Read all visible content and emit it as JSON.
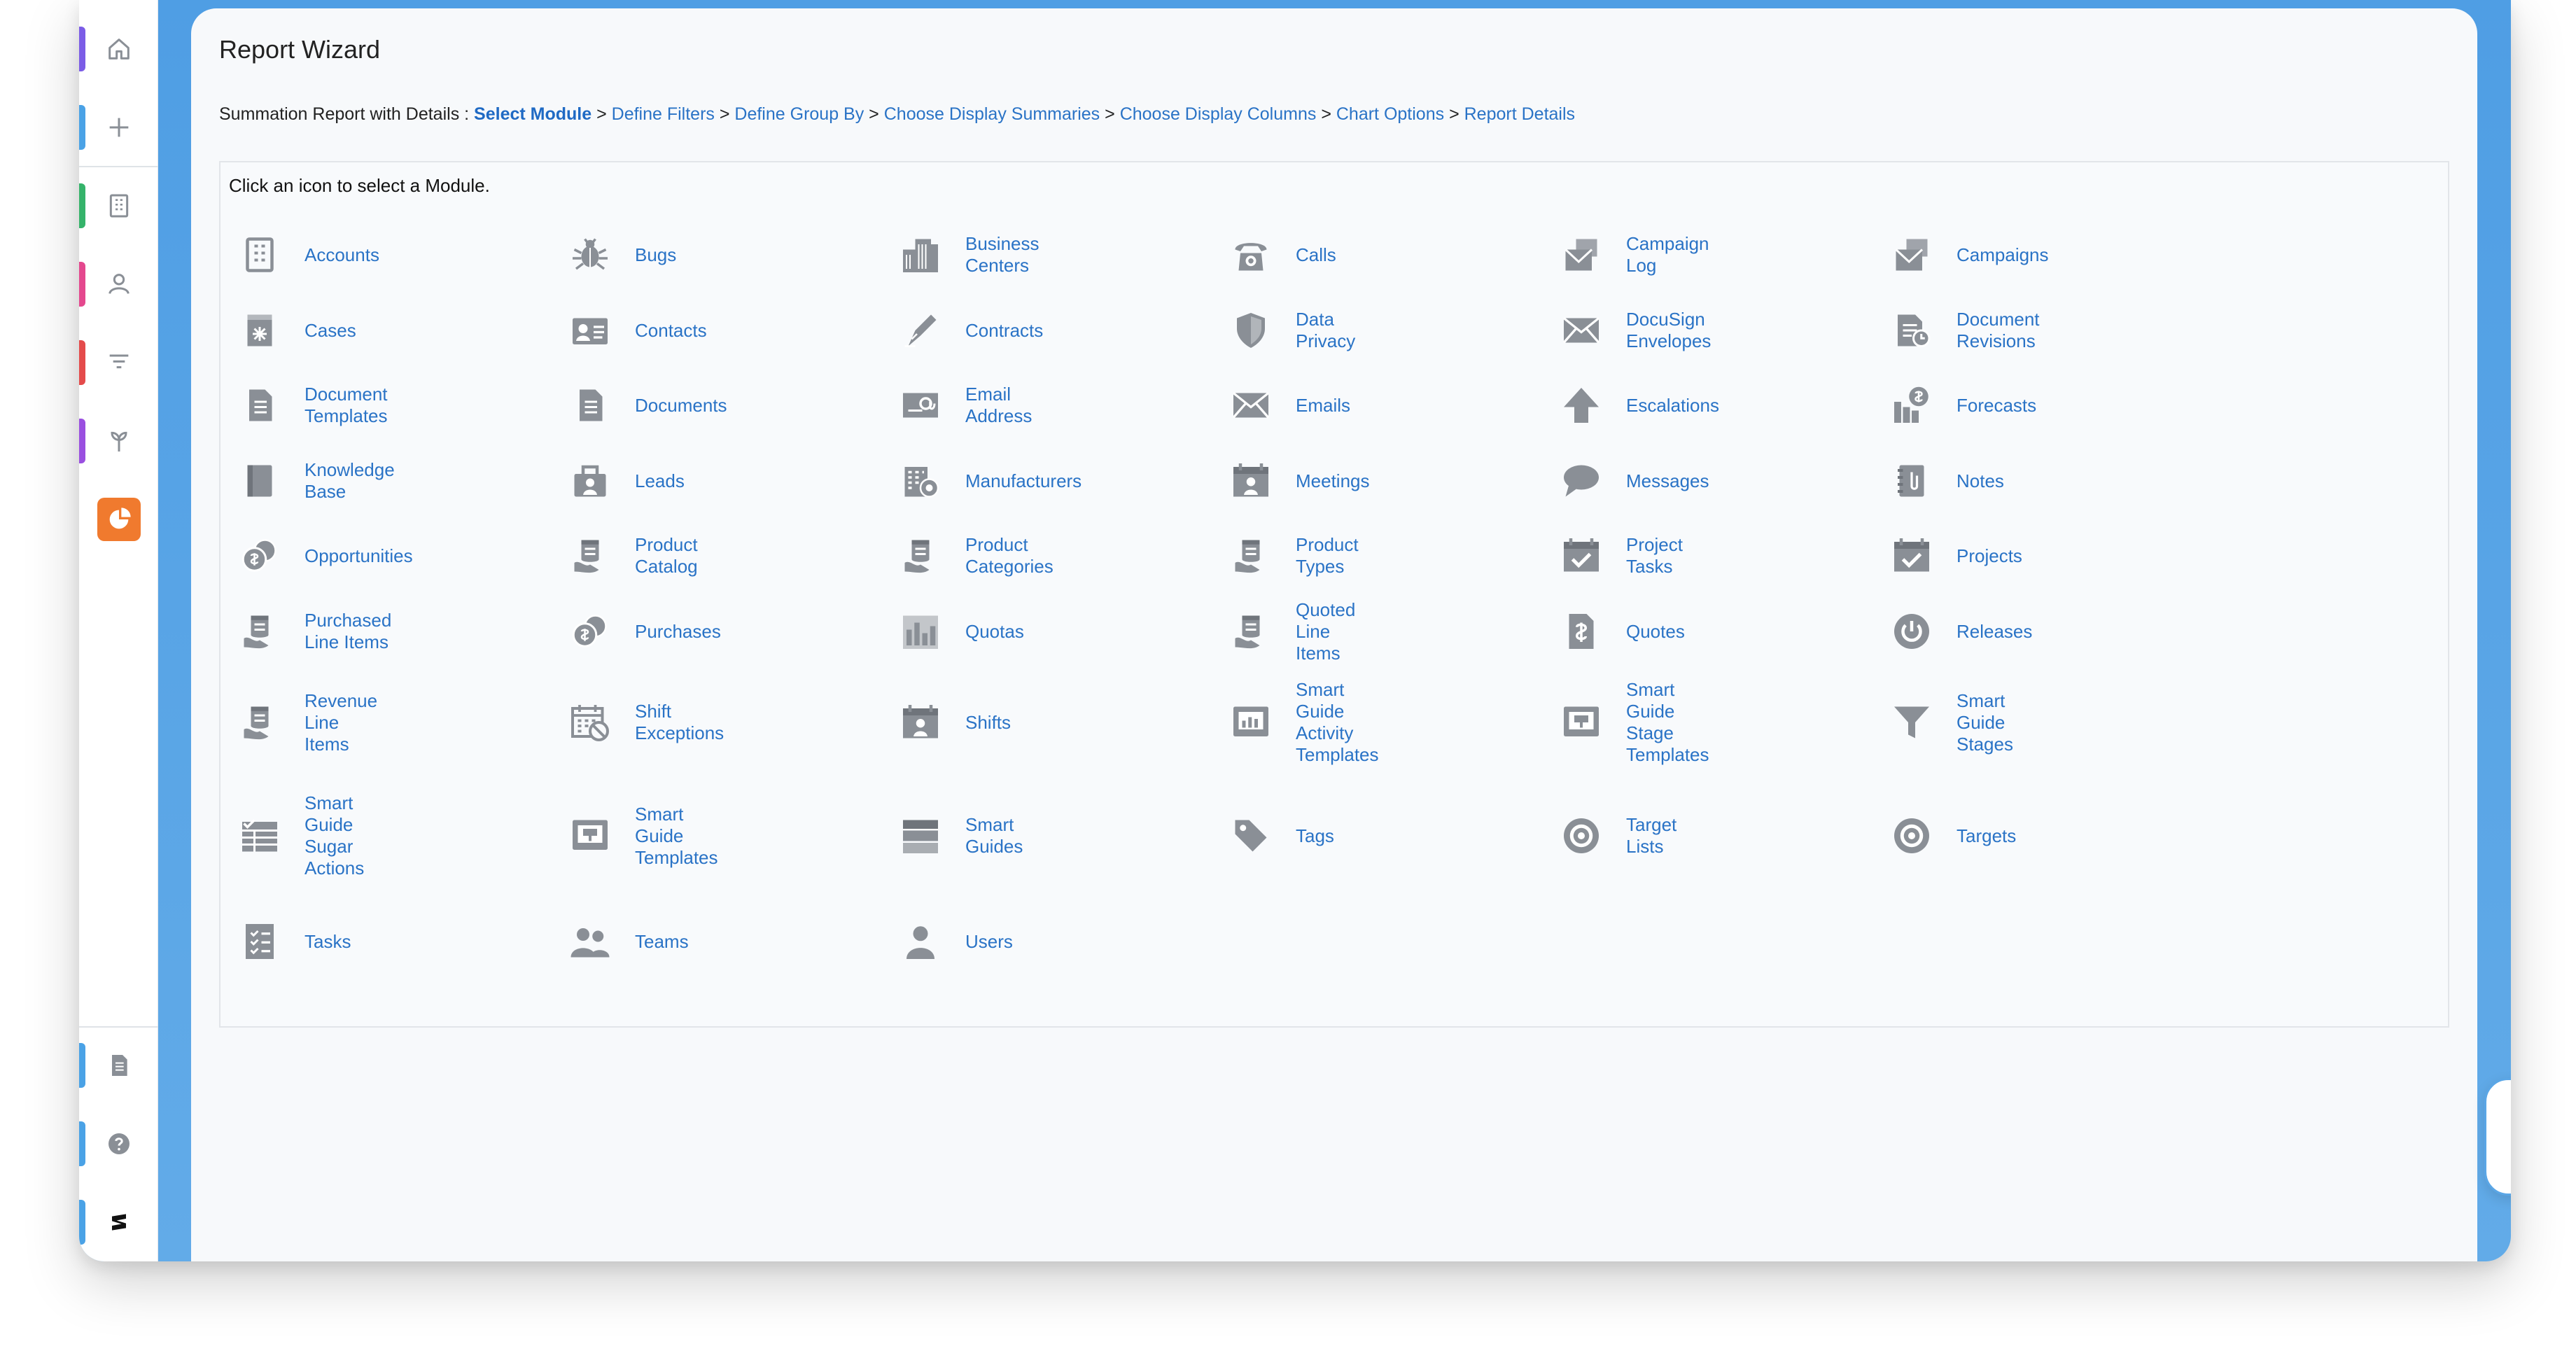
{
  "window": {
    "title": "Report Wizard",
    "colors": {
      "accent": "#2a73c6",
      "brand_orange": "#f07a2e",
      "frame": "#5aa6e6"
    }
  },
  "sidebar": {
    "top_items": [
      {
        "name": "home",
        "icon": "home-icon",
        "color": "#7b5ce6"
      },
      {
        "name": "create",
        "icon": "plus-icon",
        "color": "#4aa2e6"
      },
      {
        "name": "accounts",
        "icon": "building-icon",
        "color": "#35b36a"
      },
      {
        "name": "contacts",
        "icon": "person-icon",
        "color": "#e4488e"
      },
      {
        "name": "filters",
        "icon": "filter-icon",
        "color": "#e44b4b"
      },
      {
        "name": "opportunities",
        "icon": "plant-icon",
        "color": "#9a4fe0"
      },
      {
        "name": "reports",
        "icon": "pie-chart-icon",
        "color": "#f07a2e",
        "active": true
      }
    ],
    "bottom_items": [
      {
        "name": "notes",
        "icon": "document-icon",
        "color": "#4aa2e6"
      },
      {
        "name": "help",
        "icon": "help-icon",
        "color": "#4aa2e6"
      },
      {
        "name": "sugar",
        "icon": "sugar-logo-icon",
        "color": "#4aa2e6"
      }
    ]
  },
  "wizard": {
    "report_type": "Summation Report with Details :",
    "steps": [
      "Select Module",
      "Define Filters",
      "Define Group By",
      "Choose Display Summaries",
      "Choose Display Columns",
      "Chart Options",
      "Report Details"
    ],
    "current_step": "Select Module",
    "instruction": "Click an icon to select a Module."
  },
  "modules": [
    {
      "label": "Accounts",
      "icon": "building-icon"
    },
    {
      "label": "Bugs",
      "icon": "bug-icon"
    },
    {
      "label": "Business\nCenters",
      "icon": "office-buildings-icon"
    },
    {
      "label": "Calls",
      "icon": "phone-icon"
    },
    {
      "label": "Campaign\nLog",
      "icon": "envelope-stack-icon"
    },
    {
      "label": "Campaigns",
      "icon": "envelope-stack-icon"
    },
    {
      "label": "Cases",
      "icon": "case-icon"
    },
    {
      "label": "Contacts",
      "icon": "contact-card-icon"
    },
    {
      "label": "Contracts",
      "icon": "pen-icon"
    },
    {
      "label": "Data\nPrivacy",
      "icon": "shield-icon"
    },
    {
      "label": "DocuSign\nEnvelopes",
      "icon": "envelope-icon"
    },
    {
      "label": "Document\nRevisions",
      "icon": "document-revision-icon"
    },
    {
      "label": "Document\nTemplates",
      "icon": "document-icon"
    },
    {
      "label": "Documents",
      "icon": "document-icon"
    },
    {
      "label": "Email\nAddress",
      "icon": "email-address-icon"
    },
    {
      "label": "Emails",
      "icon": "envelope-icon"
    },
    {
      "label": "Escalations",
      "icon": "arrow-up-icon"
    },
    {
      "label": "Forecasts",
      "icon": "forecast-icon"
    },
    {
      "label": "Knowledge\nBase",
      "icon": "book-icon"
    },
    {
      "label": "Leads",
      "icon": "briefcase-person-icon"
    },
    {
      "label": "Manufacturers",
      "icon": "factory-icon"
    },
    {
      "label": "Meetings",
      "icon": "calendar-person-icon"
    },
    {
      "label": "Messages",
      "icon": "speech-bubble-icon"
    },
    {
      "label": "Notes",
      "icon": "notebook-icon"
    },
    {
      "label": "Opportunities",
      "icon": "coins-icon"
    },
    {
      "label": "Product\nCatalog",
      "icon": "product-icon"
    },
    {
      "label": "Product\nCategories",
      "icon": "product-icon"
    },
    {
      "label": "Product\nTypes",
      "icon": "product-icon"
    },
    {
      "label": "Project\nTasks",
      "icon": "calendar-check-icon"
    },
    {
      "label": "Projects",
      "icon": "calendar-check-icon"
    },
    {
      "label": "Purchased\nLine Items",
      "icon": "product-icon"
    },
    {
      "label": "Purchases",
      "icon": "coins-icon"
    },
    {
      "label": "Quotas",
      "icon": "bar-chart-icon"
    },
    {
      "label": "Quoted\nLine\nItems",
      "icon": "product-icon"
    },
    {
      "label": "Quotes",
      "icon": "dollar-document-icon"
    },
    {
      "label": "Releases",
      "icon": "power-icon"
    },
    {
      "label": "Revenue\nLine\nItems",
      "icon": "product-icon"
    },
    {
      "label": "Shift\nExceptions",
      "icon": "calendar-no-icon"
    },
    {
      "label": "Shifts",
      "icon": "calendar-person-icon"
    },
    {
      "label": "Smart\nGuide\nActivity\nTemplates",
      "icon": "monitor-chart-icon"
    },
    {
      "label": "Smart\nGuide\nStage\nTemplates",
      "icon": "monitor-icon"
    },
    {
      "label": "Smart\nGuide\nStages",
      "icon": "funnel-icon"
    },
    {
      "label": "Smart\nGuide\nSugar\nActions",
      "icon": "table-icon"
    },
    {
      "label": "Smart\nGuide\nTemplates",
      "icon": "monitor-icon"
    },
    {
      "label": "Smart\nGuides",
      "icon": "layers-icon"
    },
    {
      "label": "Tags",
      "icon": "tag-icon"
    },
    {
      "label": "Target\nLists",
      "icon": "target-icon"
    },
    {
      "label": "Targets",
      "icon": "target-icon"
    },
    {
      "label": "Tasks",
      "icon": "checklist-icon"
    },
    {
      "label": "Teams",
      "icon": "team-icon"
    },
    {
      "label": "Users",
      "icon": "user-icon"
    }
  ],
  "assistant": {
    "icon": "sparkle-icon"
  }
}
